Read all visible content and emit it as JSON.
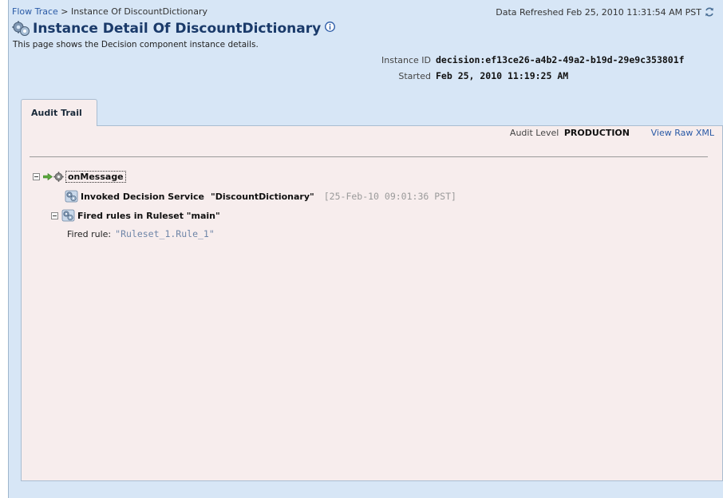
{
  "breadcrumb": {
    "parent": "Flow Trace",
    "separator": ">",
    "current": "Instance Of DiscountDictionary"
  },
  "refresh": {
    "text": "Data Refreshed Feb 25, 2010 11:31:54 AM PST",
    "icon": "refresh-icon"
  },
  "header": {
    "title": "Instance Detail Of DiscountDictionary",
    "subtitle": "This page shows the Decision component instance details.",
    "title_icon": "decision-component-icon",
    "info_icon": "info-icon"
  },
  "instance": {
    "id_label": "Instance ID",
    "id_value": "decision:ef13ce26-a4b2-49a2-b19d-29e9c353801f",
    "started_label": "Started",
    "started_value": "Feb 25, 2010 11:19:25 AM"
  },
  "tabs": [
    {
      "label": "Audit Trail",
      "selected": true
    }
  ],
  "audit": {
    "level_label": "Audit Level",
    "level_value": "PRODUCTION",
    "view_raw_label": "View Raw XML"
  },
  "trace": {
    "root": {
      "label": "onMessage",
      "expanded": true
    },
    "invoked": {
      "label": "Invoked Decision Service",
      "service": "\"DiscountDictionary\"",
      "timestamp": "[25-Feb-10 09:01:36 PST]"
    },
    "fired": {
      "label": "Fired rules in Ruleset \"main\"",
      "expanded": true,
      "rule_label": "Fired rule:",
      "rule_value": "\"Ruleset_1.Rule_1\""
    }
  },
  "colors": {
    "background": "#d7e6f6",
    "panel": "#f7eded",
    "link": "#2a5aa6",
    "title": "#1a3a6a"
  }
}
